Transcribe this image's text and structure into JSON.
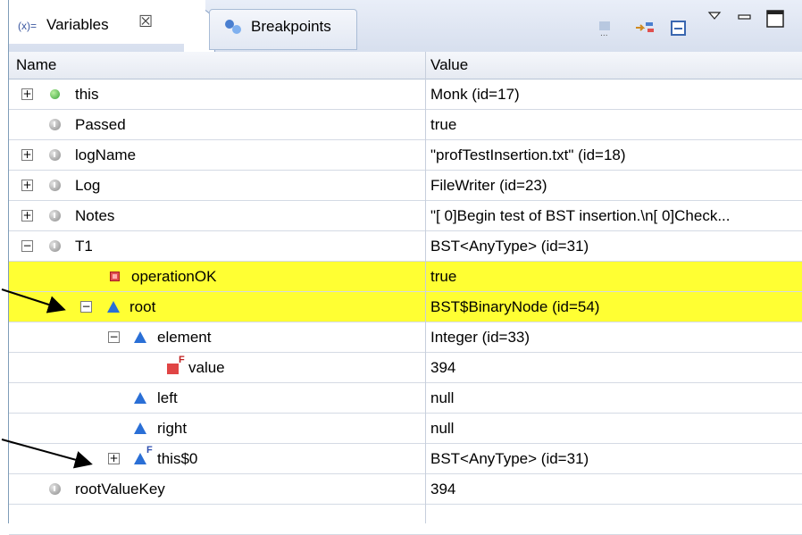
{
  "tabs": {
    "variables": {
      "icon_text": "(x)=",
      "label": "Variables",
      "close": "☒"
    },
    "breakpoints": {
      "label": "Breakpoints"
    }
  },
  "toolbar": {
    "icons": [
      "show-type-names-icon",
      "collapse-all-icon",
      "layout-icon",
      "view-menu-icon",
      "minimize-icon",
      "maximize-icon"
    ]
  },
  "columns": {
    "name": "Name",
    "value": "Value"
  },
  "rows": [
    {
      "name": "this",
      "value": "Monk  (id=17)"
    },
    {
      "name": "Passed",
      "value": "true"
    },
    {
      "name": "logName",
      "value": "\"profTestInsertion.txt\" (id=18)"
    },
    {
      "name": "Log",
      "value": "FileWriter  (id=23)"
    },
    {
      "name": "Notes",
      "value": "\"[ 0]Begin test of BST insertion.\\n[ 0]Check..."
    },
    {
      "name": "T1",
      "value": "BST<AnyType>  (id=31)"
    },
    {
      "name": "operationOK",
      "value": "true"
    },
    {
      "name": "root",
      "value": "BST$BinaryNode  (id=54)"
    },
    {
      "name": "element",
      "value": "Integer  (id=33)"
    },
    {
      "name": "value",
      "value": "394"
    },
    {
      "name": "left",
      "value": "null"
    },
    {
      "name": "right",
      "value": "null"
    },
    {
      "name": "this$0",
      "value": "BST<AnyType>  (id=31)"
    },
    {
      "name": "rootValueKey",
      "value": "394"
    }
  ],
  "colors": {
    "highlight": "#ffff33",
    "accent": "#2a6fd6"
  }
}
